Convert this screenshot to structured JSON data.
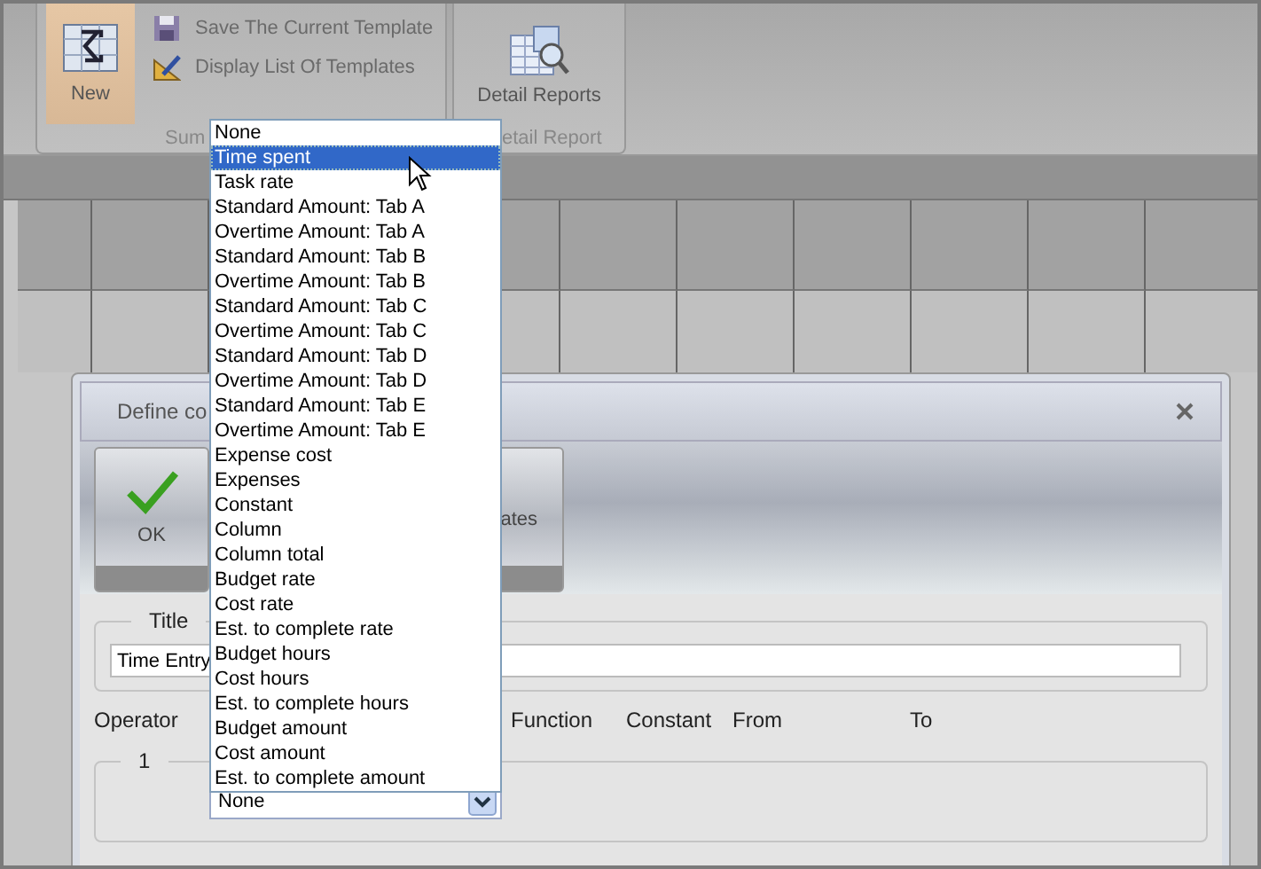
{
  "ribbon": {
    "new_button": {
      "label": "New",
      "highlighted": true
    },
    "template_actions": [
      {
        "label": "Save The Current Template",
        "kind": "save"
      },
      {
        "label": "Display List Of Templates",
        "kind": "list"
      }
    ],
    "group_labels": [
      "Sum",
      "etail Report"
    ],
    "detail_button": {
      "label": "Detail Reports"
    }
  },
  "dialog": {
    "title": "Define co",
    "toolbar": [
      {
        "label": "OK",
        "kind": "ok"
      },
      {
        "label": "ates",
        "kind": "templates"
      }
    ],
    "title_field": {
      "legend": "Title",
      "value": "Time Entry"
    },
    "column_headers": [
      "Operator",
      "Function",
      "Constant",
      "From",
      "To"
    ],
    "row_group": {
      "legend": "1",
      "select": {
        "value": "None"
      }
    }
  },
  "dropdown": {
    "items": [
      {
        "label": "None",
        "selected": false
      },
      {
        "label": "Time spent",
        "selected": true
      },
      {
        "label": "Task rate",
        "selected": false
      },
      {
        "label": "Standard Amount: Tab A",
        "selected": false
      },
      {
        "label": "Overtime Amount: Tab A",
        "selected": false
      },
      {
        "label": "Standard Amount: Tab B",
        "selected": false
      },
      {
        "label": "Overtime Amount: Tab B",
        "selected": false
      },
      {
        "label": "Standard Amount: Tab C",
        "selected": false
      },
      {
        "label": "Overtime Amount: Tab C",
        "selected": false
      },
      {
        "label": "Standard Amount: Tab D",
        "selected": false
      },
      {
        "label": "Overtime Amount: Tab D",
        "selected": false
      },
      {
        "label": "Standard Amount: Tab E",
        "selected": false
      },
      {
        "label": "Overtime Amount: Tab E",
        "selected": false
      },
      {
        "label": "Expense cost",
        "selected": false
      },
      {
        "label": "Expenses",
        "selected": false
      },
      {
        "label": "Constant",
        "selected": false
      },
      {
        "label": "Column",
        "selected": false
      },
      {
        "label": "Column total",
        "selected": false
      },
      {
        "label": "Budget rate",
        "selected": false
      },
      {
        "label": "Cost rate",
        "selected": false
      },
      {
        "label": "Est. to complete rate",
        "selected": false
      },
      {
        "label": "Budget hours",
        "selected": false
      },
      {
        "label": "Cost hours",
        "selected": false
      },
      {
        "label": "Est. to complete hours",
        "selected": false
      },
      {
        "label": "Budget amount",
        "selected": false
      },
      {
        "label": "Cost amount",
        "selected": false
      },
      {
        "label": "Est. to complete amount",
        "selected": false
      }
    ]
  }
}
